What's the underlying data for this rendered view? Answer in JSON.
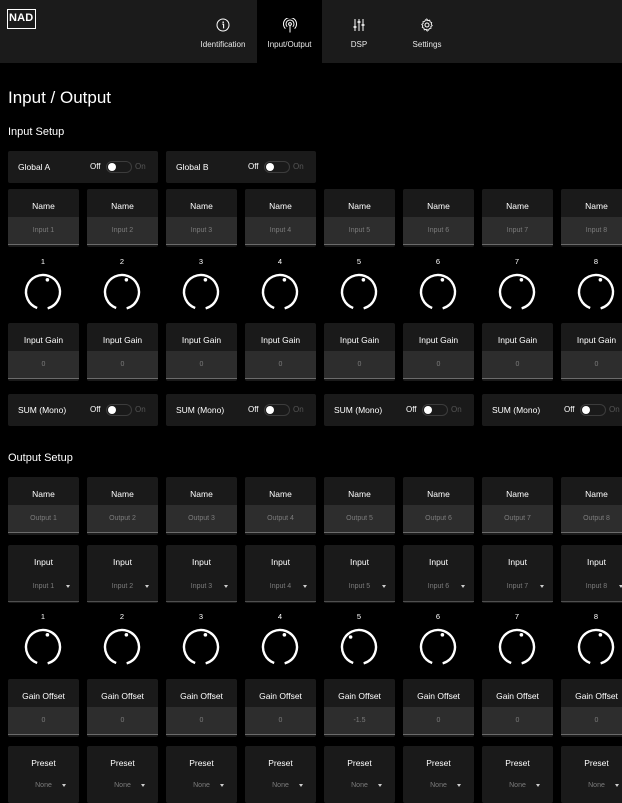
{
  "header": {
    "logo_text": "NAD",
    "tabs": [
      {
        "label": "Identification",
        "icon": "info-icon"
      },
      {
        "label": "Input/Output",
        "icon": "broadcast-icon"
      },
      {
        "label": "DSP",
        "icon": "sliders-icon"
      },
      {
        "label": "Settings",
        "icon": "gear-icon"
      }
    ],
    "active_tab": "Input/Output"
  },
  "page_title": "Input / Output",
  "input_setup": {
    "title": "Input Setup",
    "global": [
      {
        "label": "Global A",
        "off": "Off",
        "on": "On",
        "state": "off"
      },
      {
        "label": "Global B",
        "off": "Off",
        "on": "On",
        "state": "off"
      }
    ],
    "name_label": "Name",
    "names": [
      "Input 1",
      "Input 2",
      "Input 3",
      "Input 4",
      "Input 5",
      "Input 6",
      "Input 7",
      "Input 8"
    ],
    "channels": [
      "1",
      "2",
      "3",
      "4",
      "5",
      "6",
      "7",
      "8"
    ],
    "gain_label": "Input Gain",
    "gains": [
      "0",
      "0",
      "0",
      "0",
      "0",
      "0",
      "0",
      "0"
    ],
    "sum": [
      {
        "label": "SUM (Mono)",
        "off": "Off",
        "on": "On",
        "state": "off"
      },
      {
        "label": "SUM (Mono)",
        "off": "Off",
        "on": "On",
        "state": "off"
      },
      {
        "label": "SUM (Mono)",
        "off": "Off",
        "on": "On",
        "state": "off"
      },
      {
        "label": "SUM (Mono)",
        "off": "Off",
        "on": "On",
        "state": "off"
      }
    ]
  },
  "output_setup": {
    "title": "Output Setup",
    "name_label": "Name",
    "names": [
      "Output 1",
      "Output 2",
      "Output 3",
      "Output 4",
      "Output 5",
      "Output 6",
      "Output 7",
      "Output 8"
    ],
    "input_label": "Input",
    "inputs": [
      "Input 1",
      "Input 2",
      "Input 3",
      "Input 4",
      "Input 5",
      "Input 6",
      "Input 7",
      "Input 8"
    ],
    "channels": [
      "1",
      "2",
      "3",
      "4",
      "5",
      "6",
      "7",
      "8"
    ],
    "gain_offset_label": "Gain Offset",
    "gain_offsets": [
      "0",
      "0",
      "0",
      "0",
      "-1.5",
      "0",
      "0",
      "0"
    ],
    "preset_label": "Preset",
    "presets": [
      "None",
      "None",
      "None",
      "None",
      "None",
      "None",
      "None",
      "None"
    ]
  },
  "colors": {
    "background": "#000000",
    "card": "#1a1a1a",
    "field": "#2d2d2d",
    "topbar": "#1b1b1b",
    "text": "#ffffff",
    "muted": "#7c7c7c"
  }
}
